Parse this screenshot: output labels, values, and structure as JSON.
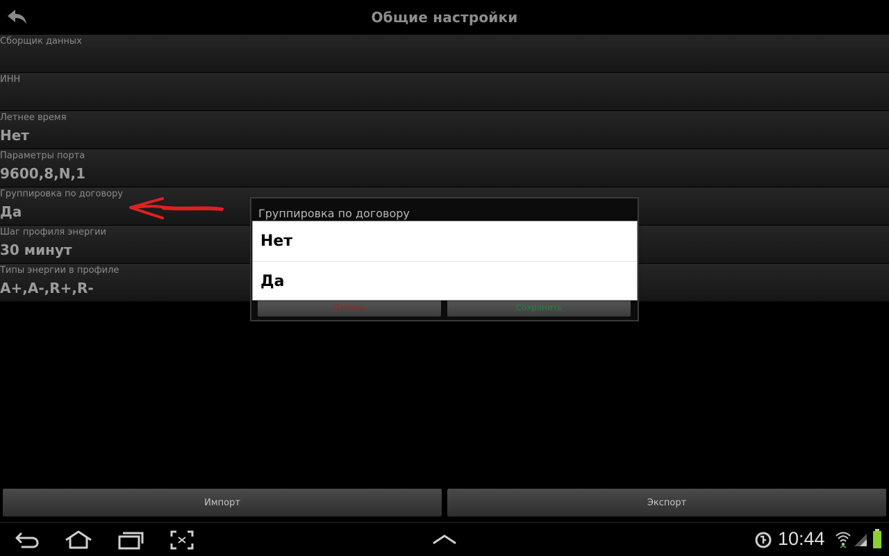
{
  "header": {
    "title": "Общие настройки",
    "back_icon": "back-arrow-icon"
  },
  "settings": [
    {
      "label": "Сборщик данных",
      "value": ""
    },
    {
      "label": "ИНН",
      "value": ""
    },
    {
      "label": "Летнее время",
      "value": "Нет"
    },
    {
      "label": "Параметры порта",
      "value": "9600,8,N,1"
    },
    {
      "label": "Группировка по договору",
      "value": "Да"
    },
    {
      "label": "Шаг профиля энергии",
      "value": "30 минут"
    },
    {
      "label": "Типы энергии в профиле",
      "value": "A+,A-,R+,R-"
    }
  ],
  "dialog": {
    "title": "Группировка по договору",
    "cancel_label": "Отмена",
    "save_label": "Сохранить",
    "options": [
      "Нет",
      "Да"
    ]
  },
  "footer": {
    "import_label": "Импорт",
    "export_label": "Экспорт"
  },
  "status_bar": {
    "time": "10:44"
  },
  "colors": {
    "annotation": "#e02020",
    "cancel": "#a02020",
    "save": "#208040"
  }
}
